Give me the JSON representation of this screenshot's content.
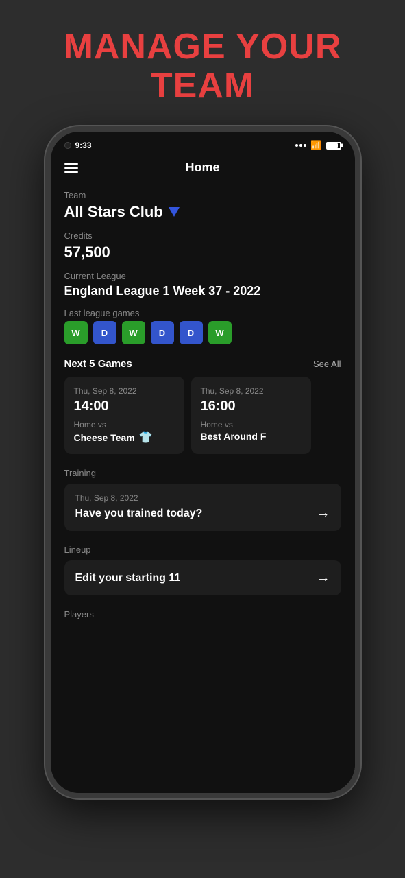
{
  "page": {
    "title_line1": "MANAGE YOUR",
    "title_line2": "TEAM"
  },
  "status_bar": {
    "time": "9:33",
    "battery_level": "85"
  },
  "nav": {
    "title": "Home",
    "menu_label": "Menu"
  },
  "team": {
    "label": "Team",
    "name": "All Stars Club"
  },
  "credits": {
    "label": "Credits",
    "value": "57,500"
  },
  "league": {
    "label": "Current League",
    "name": "England League 1 Week 37 - 2022"
  },
  "last_games": {
    "label": "Last league games",
    "results": [
      {
        "result": "W",
        "type": "w"
      },
      {
        "result": "D",
        "type": "d"
      },
      {
        "result": "W",
        "type": "w"
      },
      {
        "result": "D",
        "type": "d"
      },
      {
        "result": "D",
        "type": "d"
      },
      {
        "result": "W",
        "type": "w"
      }
    ]
  },
  "next_games": {
    "label": "Next 5 Games",
    "see_all": "See All",
    "games": [
      {
        "date": "Thu, Sep 8, 2022",
        "time": "14:00",
        "vs_label": "Home vs",
        "opponent": "Cheese Team",
        "has_shirt": true
      },
      {
        "date": "Thu, Sep 8, 2022",
        "time": "16:00",
        "vs_label": "Home vs",
        "opponent": "Best Around F",
        "has_shirt": false
      }
    ]
  },
  "training": {
    "label": "Training",
    "date": "Thu, Sep 8, 2022",
    "prompt": "Have you trained today?",
    "arrow": "→"
  },
  "lineup": {
    "label": "Lineup",
    "title": "Edit your starting 11",
    "arrow": "→"
  },
  "players": {
    "label": "Players"
  }
}
